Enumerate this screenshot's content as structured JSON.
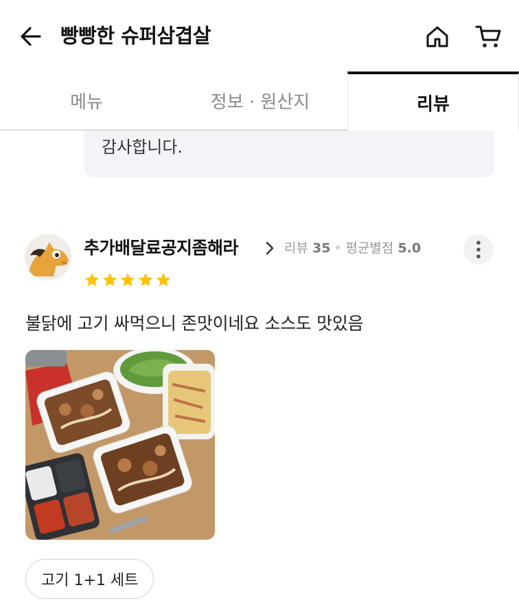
{
  "header": {
    "store_name": "빵빵한 슈퍼삼겹살",
    "back_icon": "arrow-left-icon",
    "home_icon": "home-icon",
    "cart_icon": "cart-icon"
  },
  "tabs": [
    {
      "label": "메뉴",
      "active": false
    },
    {
      "label": "정보 · 원산지",
      "active": false
    },
    {
      "label": "리뷰",
      "active": true
    }
  ],
  "previous_reply": {
    "text": "감사합니다."
  },
  "review": {
    "reviewer_name": "추가배달료공지좀해라",
    "review_count_label": "리뷰",
    "review_count": "35",
    "avg_rating_label": "평균별점",
    "avg_rating": "5.0",
    "rating": 5,
    "rating_max": 5,
    "text": "불닭에 고기 싸먹으니 존맛이네요 소스도 맛있음",
    "ordered_menu": "고기 1+1 세트"
  },
  "colors": {
    "star": "#FFC107",
    "active_tab_border": "#111111",
    "reply_bg": "#F3F4F7"
  }
}
